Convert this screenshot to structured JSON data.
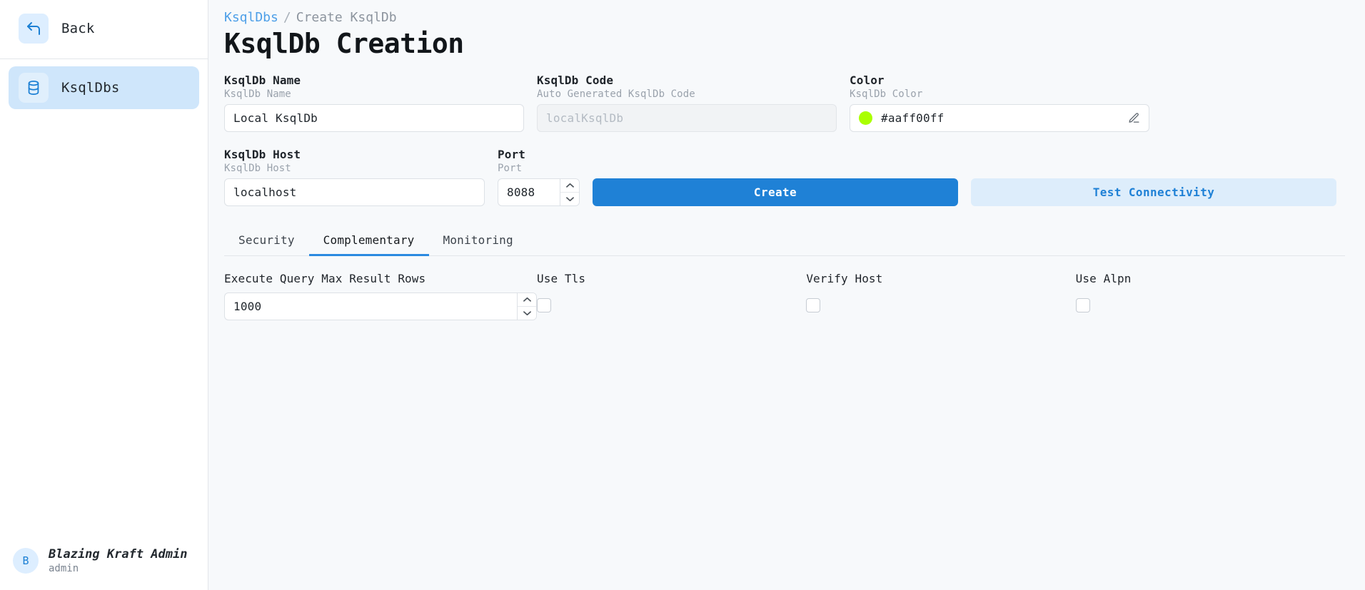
{
  "sidebar": {
    "back": {
      "label": "Back",
      "icon": "back-arrow-icon"
    },
    "items": [
      {
        "label": "KsqlDbs",
        "icon": "database-icon",
        "active": true
      }
    ],
    "user": {
      "initial": "B",
      "name": "Blazing Kraft Admin",
      "role": "admin"
    }
  },
  "breadcrumb": {
    "root": "KsqlDbs",
    "separator": "/",
    "current": "Create KsqlDb"
  },
  "page": {
    "title": "KsqlDb Creation"
  },
  "form": {
    "name": {
      "label": "KsqlDb Name",
      "sub": "KsqlDb Name",
      "value": "Local KsqlDb"
    },
    "code": {
      "label": "KsqlDb Code",
      "sub": "Auto Generated KsqlDb Code",
      "value": "localKsqlDb"
    },
    "color": {
      "label": "Color",
      "sub": "KsqlDb Color",
      "value": "#aaff00ff",
      "swatch": "#aaff00",
      "edit_icon": "pencil-icon"
    },
    "host": {
      "label": "KsqlDb Host",
      "sub": "KsqlDb Host",
      "value": "localhost"
    },
    "port": {
      "label": "Port",
      "sub": "Port",
      "value": "8088",
      "increment_icon": "chevron-up-icon",
      "decrement_icon": "chevron-down-icon"
    },
    "create_button": "Create",
    "test_button": "Test Connectivity"
  },
  "tabs": [
    {
      "label": "Security",
      "active": false
    },
    {
      "label": "Complementary",
      "active": true
    },
    {
      "label": "Monitoring",
      "active": false
    }
  ],
  "complementary": {
    "max_rows": {
      "label": "Execute Query Max Result Rows",
      "value": "1000",
      "increment_icon": "chevron-up-icon",
      "decrement_icon": "chevron-down-icon"
    },
    "use_tls": {
      "label": "Use Tls",
      "checked": false
    },
    "verify_host": {
      "label": "Verify Host",
      "checked": false
    },
    "use_alpn": {
      "label": "Use Alpn",
      "checked": false
    }
  },
  "colors": {
    "accent": "#1f81d6",
    "accent_soft": "#ddedfb",
    "nav_active": "#cfe6fb",
    "swatch": "#aaff00"
  }
}
